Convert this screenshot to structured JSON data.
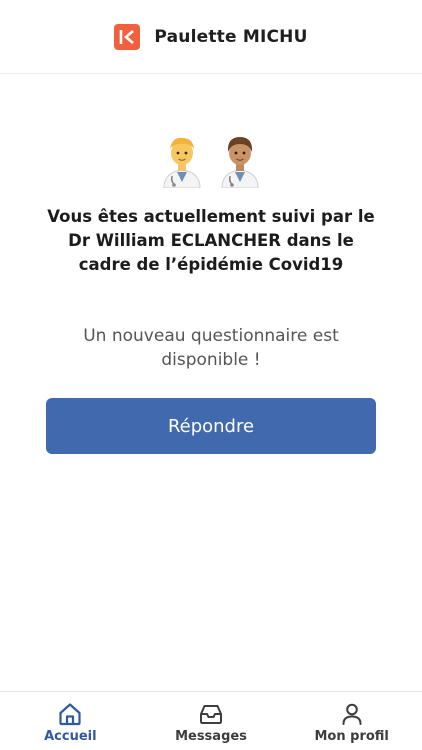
{
  "header": {
    "title": "Paulette MICHU",
    "logo_icon": "brand-logo-icon",
    "logo_color": "#f0603e"
  },
  "main": {
    "emoji_icons": [
      "doctor-man-icon",
      "doctor-person-icon"
    ],
    "followed_text_line1": "Vous êtes actuellement suivi par le",
    "followed_text_line2": "Dr William ECLANCHER dans le",
    "followed_text_line3": "cadre de l’épidémie Covid19",
    "notice_line1": "Un nouveau questionnaire est",
    "notice_line2": "disponible !",
    "answer_button": "Répondre",
    "button_color": "#4169ad"
  },
  "tabbar": {
    "tabs": [
      {
        "label": "Accueil",
        "icon": "home-icon",
        "active": true
      },
      {
        "label": "Messages",
        "icon": "inbox-icon",
        "active": false
      },
      {
        "label": "Mon profil",
        "icon": "user-icon",
        "active": false
      }
    ],
    "active_color": "#2f5aa0"
  }
}
